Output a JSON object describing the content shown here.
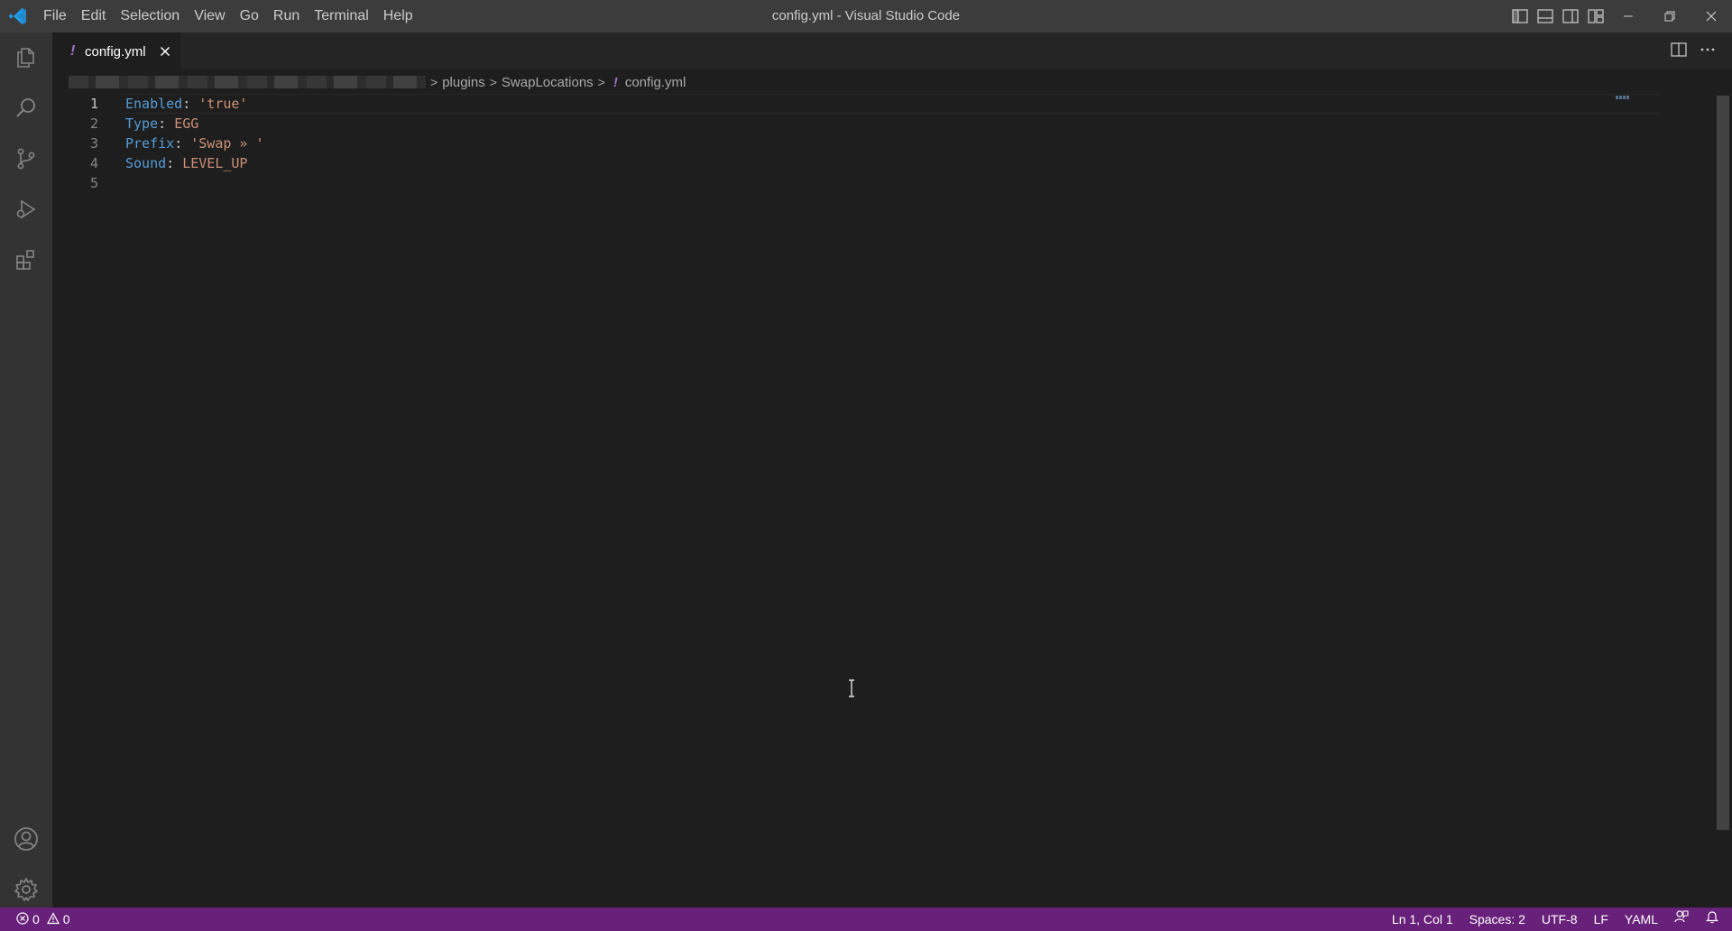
{
  "window": {
    "title": "config.yml - Visual Studio Code"
  },
  "menu": [
    "File",
    "Edit",
    "Selection",
    "View",
    "Go",
    "Run",
    "Terminal",
    "Help"
  ],
  "tab": {
    "icon_text": "!",
    "label": "config.yml"
  },
  "breadcrumbs": {
    "parts": [
      "plugins",
      "SwapLocations"
    ],
    "file_icon_text": "!",
    "file": "config.yml",
    "separator": ">"
  },
  "editor": {
    "lines": [
      {
        "number": "1",
        "key": "Enabled",
        "colon": ": ",
        "value": "'true'"
      },
      {
        "number": "2",
        "key": "Type",
        "colon": ": ",
        "value": "EGG"
      },
      {
        "number": "3",
        "key": "Prefix",
        "colon": ": ",
        "value": "'Swap » '"
      },
      {
        "number": "4",
        "key": "Sound",
        "colon": ": ",
        "value": "LEVEL_UP"
      },
      {
        "number": "5",
        "key": "",
        "colon": "",
        "value": ""
      }
    ]
  },
  "status": {
    "errors": "0",
    "warnings": "0",
    "position": "Ln 1, Col 1",
    "indent": "Spaces: 2",
    "encoding": "UTF-8",
    "eol": "LF",
    "language": "YAML"
  },
  "colors": {
    "statusbar": "#68217a",
    "keyword": "#569cd6",
    "string": "#ce9178",
    "yaml_icon": "#a074c4"
  },
  "icons": {
    "app": "vscode-logo-icon",
    "activity": [
      "explorer-icon",
      "search-icon",
      "source-control-icon",
      "run-debug-icon",
      "extensions-icon",
      "account-icon",
      "settings-gear-icon"
    ]
  }
}
